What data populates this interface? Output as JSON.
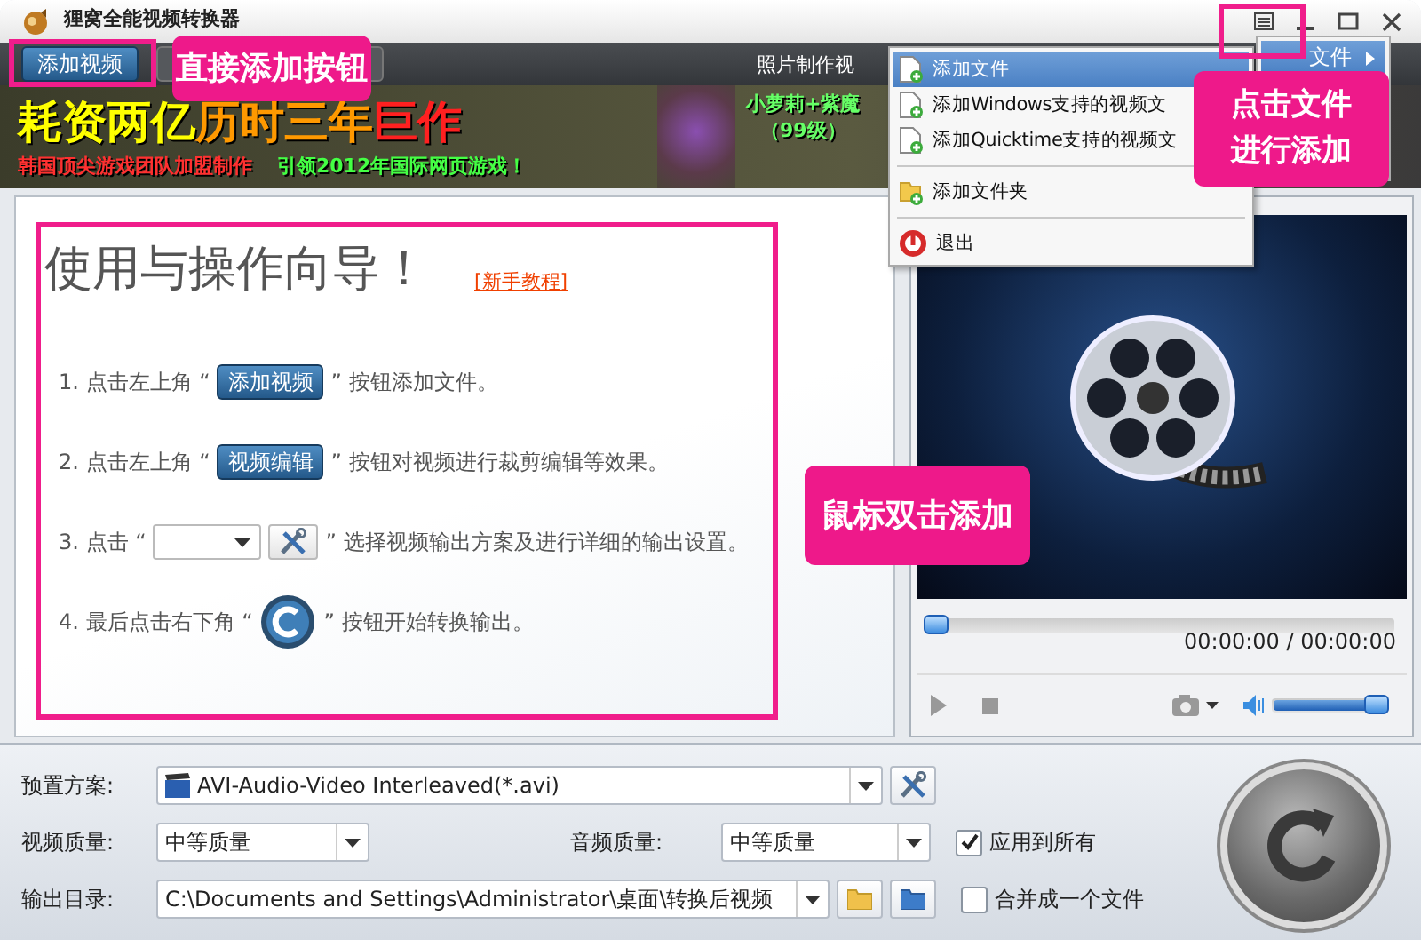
{
  "window": {
    "title": "狸窝全能视频转换器"
  },
  "toolbar": {
    "add_video_button": "添加视频",
    "right_label": "照片制作视"
  },
  "banner": {
    "headline": [
      {
        "text": "耗资两亿",
        "color": "#ffff00"
      },
      {
        "text": "历时三年",
        "color": "#ff9900"
      },
      {
        "text": "巨作",
        "color": "#ff2020"
      }
    ],
    "taglines": [
      {
        "text": "韩国顶尖游戏团队加盟制作",
        "color": "#ff3030"
      },
      {
        "text": "引领2012年国际网页游戏！",
        "color": "#44ff44"
      }
    ],
    "side_texts": [
      "小萝莉+紫魔",
      "（99级）"
    ]
  },
  "guide": {
    "title": "使用与操作向导！",
    "link": "[新手教程]",
    "steps": [
      {
        "kind": "button",
        "number": "1.",
        "before": "点击左上角 “",
        "button_label": "添加视频",
        "after": "” 按钮添加文件。"
      },
      {
        "kind": "button",
        "number": "2.",
        "before": "点击左上角 “",
        "button_label": "视频编辑",
        "after": "” 按钮对视频进行裁剪编辑等效果。"
      },
      {
        "kind": "combo",
        "number": "3.",
        "before": "点击 “",
        "after": "” 选择视频输出方案及进行详细的输出设置。"
      },
      {
        "kind": "round",
        "number": "4.",
        "before": "最后点击右下角 “",
        "after": "” 按钮开始转换输出。"
      }
    ]
  },
  "player": {
    "progress": {
      "level": 0
    },
    "time": "00:00:00 / 00:00:00",
    "volume": {
      "level": 1
    }
  },
  "settings": {
    "preset_label": "预置方案:",
    "preset_value": "AVI-Audio-Video Interleaved(*.avi)",
    "video_quality_label": "视频质量:",
    "video_quality_value": "中等质量",
    "audio_quality_label": "音频质量:",
    "audio_quality_value": "中等质量",
    "apply_all": {
      "label": "应用到所有",
      "checked": true
    },
    "output_label": "输出目录:",
    "output_value": "C:\\Documents and Settings\\Administrator\\桌面\\转换后视频",
    "merge": {
      "label": "合并成一个文件",
      "checked": false
    }
  },
  "menu": {
    "groups": [
      [
        {
          "kind": "file",
          "label": "添加文件",
          "selected": true
        },
        {
          "kind": "file",
          "label": "添加Windows支持的视频文",
          "selected": false
        },
        {
          "kind": "file",
          "label": "添加Quicktime支持的视频文",
          "selected": false
        }
      ],
      [
        {
          "kind": "folder",
          "label": "添加文件夹",
          "selected": false
        }
      ],
      [
        {
          "kind": "exit",
          "label": "退出",
          "selected": false
        }
      ]
    ]
  },
  "submenu": {
    "items": [
      {
        "label": "文件",
        "selected": true
      }
    ]
  },
  "callouts": [
    {
      "lines": [
        "直接添加按钮"
      ]
    },
    {
      "lines": [
        "点击文件",
        "进行添加"
      ]
    },
    {
      "lines": [
        "鼠标双击添加"
      ]
    }
  ]
}
